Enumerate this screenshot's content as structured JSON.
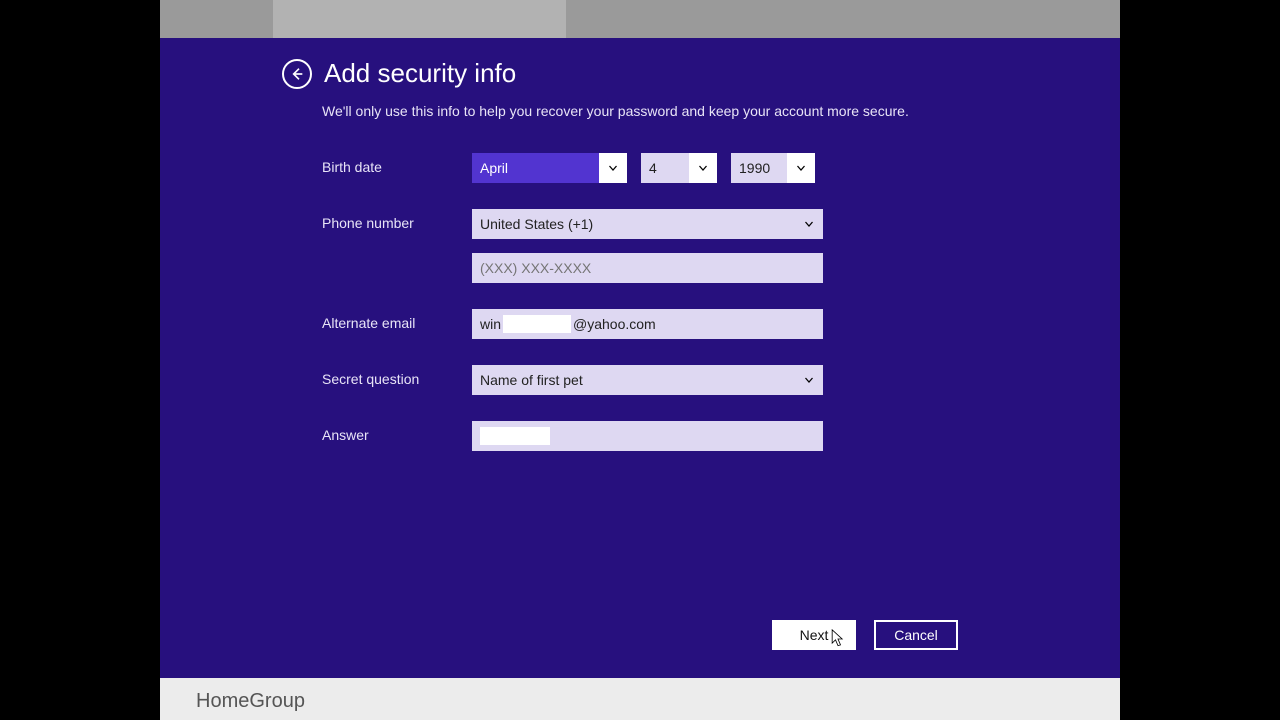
{
  "header": {
    "title": "Add security info",
    "subtitle": "We'll only use this info to help you recover your password and keep your account more secure."
  },
  "form": {
    "birth_label": "Birth date",
    "birth_month": "April",
    "birth_day": "4",
    "birth_year": "1990",
    "phone_label": "Phone number",
    "phone_country": "United States (+1)",
    "phone_placeholder": "(XXX) XXX-XXXX",
    "phone_value": "",
    "alt_email_label": "Alternate email",
    "alt_email_prefix": "win",
    "alt_email_suffix": "@yahoo.com",
    "question_label": "Secret question",
    "question_value": "Name of first pet",
    "answer_label": "Answer",
    "answer_value": ""
  },
  "buttons": {
    "next": "Next",
    "cancel": "Cancel"
  },
  "footer": {
    "text": "HomeGroup"
  }
}
